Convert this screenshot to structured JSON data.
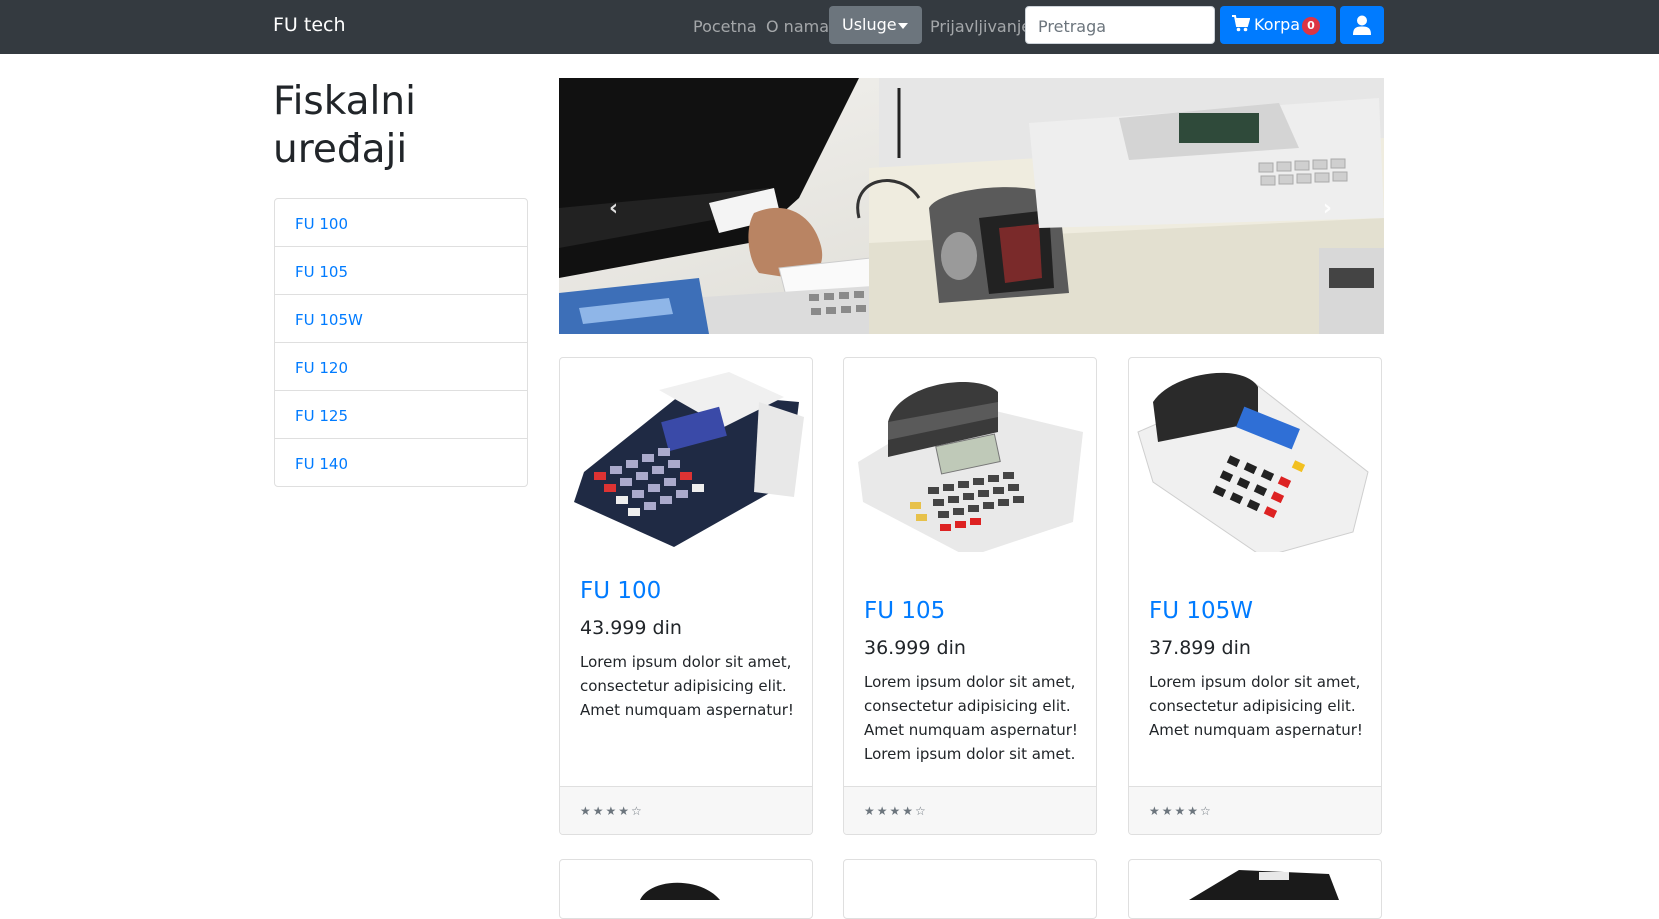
{
  "navbar": {
    "brand": "FU tech",
    "links": {
      "home": "Pocetna",
      "about": "O nama",
      "services": "Usluge",
      "login": "Prijavljivanje"
    },
    "search": {
      "placeholder": "Pretraga"
    },
    "cart": {
      "label": "Korpa",
      "count": "0"
    },
    "colors": {
      "background": "#343a40",
      "primary": "#007bff",
      "badge": "#dc3545",
      "dropdown": "#6c757d"
    }
  },
  "sidebar": {
    "title": "Fiskalni uređaji",
    "items": [
      {
        "label": "FU 100"
      },
      {
        "label": "FU 105"
      },
      {
        "label": "FU 105W"
      },
      {
        "label": "FU 120"
      },
      {
        "label": "FU 125"
      },
      {
        "label": "FU 140"
      }
    ]
  },
  "carousel": {
    "prev_icon": "‹",
    "next_icon": "›"
  },
  "products": [
    {
      "title": "FU 100",
      "price": "43.999 din",
      "description": "Lorem ipsum dolor sit amet, consectetur adipisicing elit. Amet numquam aspernatur!",
      "rating": "★★★★☆"
    },
    {
      "title": "FU 105",
      "price": "36.999 din",
      "description": "Lorem ipsum dolor sit amet, consectetur adipisicing elit. Amet numquam aspernatur! Lorem ipsum dolor sit amet.",
      "rating": "★★★★☆"
    },
    {
      "title": "FU 105W",
      "price": "37.899 din",
      "description": "Lorem ipsum dolor sit amet, consectetur adipisicing elit. Amet numquam aspernatur!",
      "rating": "★★★★☆"
    }
  ]
}
